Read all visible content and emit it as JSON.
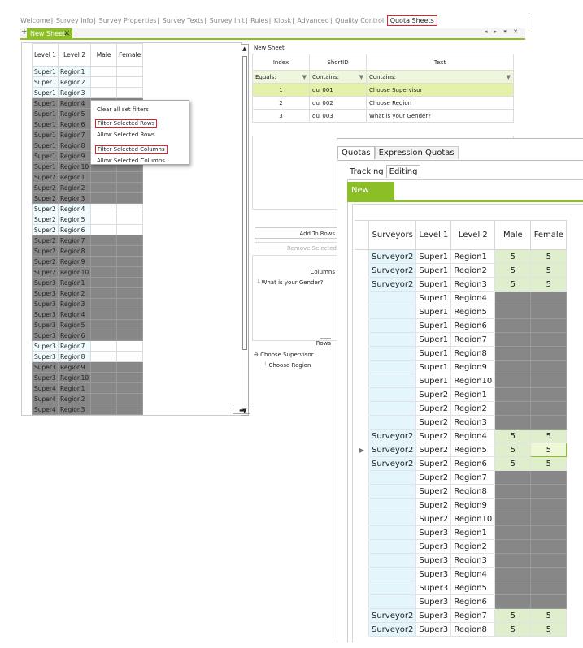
{
  "back_window": {
    "tabs": [
      "Welcome",
      "Survey Info",
      "Survey Properties",
      "Survey Texts",
      "Survey Init",
      "Rules",
      "Kiosk",
      "Advanced",
      "Quality Control",
      "Quota Sheets"
    ],
    "active_tab": "Quota Sheets",
    "sheet_tab": {
      "plus": "+",
      "label": "New Sheet",
      "close": "✕"
    },
    "window_controls": "◂ ▸ ▾ ✕",
    "grid": {
      "headers": [
        "Level 1",
        "Level 2",
        "Male",
        "Female"
      ],
      "rows": [
        {
          "l1": "Super1",
          "l2": "Region1",
          "g": false
        },
        {
          "l1": "Super1",
          "l2": "Region2",
          "g": false
        },
        {
          "l1": "Super1",
          "l2": "Region3",
          "g": false
        },
        {
          "l1": "Super1",
          "l2": "Region4",
          "g": true
        },
        {
          "l1": "Super1",
          "l2": "Region5",
          "g": true
        },
        {
          "l1": "Super1",
          "l2": "Region6",
          "g": true
        },
        {
          "l1": "Super1",
          "l2": "Region7",
          "g": true
        },
        {
          "l1": "Super1",
          "l2": "Region8",
          "g": true
        },
        {
          "l1": "Super1",
          "l2": "Region9",
          "g": true
        },
        {
          "l1": "Super1",
          "l2": "Region10",
          "g": true
        },
        {
          "l1": "Super2",
          "l2": "Region1",
          "g": true
        },
        {
          "l1": "Super2",
          "l2": "Region2",
          "g": true
        },
        {
          "l1": "Super2",
          "l2": "Region3",
          "g": true
        },
        {
          "l1": "Super2",
          "l2": "Region4",
          "g": false
        },
        {
          "l1": "Super2",
          "l2": "Region5",
          "g": false
        },
        {
          "l1": "Super2",
          "l2": "Region6",
          "g": false
        },
        {
          "l1": "Super2",
          "l2": "Region7",
          "g": true
        },
        {
          "l1": "Super2",
          "l2": "Region8",
          "g": true
        },
        {
          "l1": "Super2",
          "l2": "Region9",
          "g": true
        },
        {
          "l1": "Super2",
          "l2": "Region10",
          "g": true
        },
        {
          "l1": "Super3",
          "l2": "Region1",
          "g": true
        },
        {
          "l1": "Super3",
          "l2": "Region2",
          "g": true
        },
        {
          "l1": "Super3",
          "l2": "Region3",
          "g": true
        },
        {
          "l1": "Super3",
          "l2": "Region4",
          "g": true
        },
        {
          "l1": "Super3",
          "l2": "Region5",
          "g": true
        },
        {
          "l1": "Super3",
          "l2": "Region6",
          "g": true
        },
        {
          "l1": "Super3",
          "l2": "Region7",
          "g": false
        },
        {
          "l1": "Super3",
          "l2": "Region8",
          "g": false
        },
        {
          "l1": "Super3",
          "l2": "Region9",
          "g": true
        },
        {
          "l1": "Super3",
          "l2": "Region10",
          "g": true
        },
        {
          "l1": "Super4",
          "l2": "Region1",
          "g": true
        },
        {
          "l1": "Super4",
          "l2": "Region2",
          "g": true
        },
        {
          "l1": "Super4",
          "l2": "Region3",
          "g": true
        },
        {
          "l1": "Super4",
          "l2": "Region4",
          "g": true
        }
      ]
    },
    "context_menu": [
      "Clear all set filters",
      "Filter Selected Rows",
      "Allow Selected Rows",
      "Filter Selected Columns",
      "Allow Selected Columns"
    ],
    "right_pane": {
      "title": "New Sheet",
      "headers": [
        "Index",
        "ShortID",
        "Text"
      ],
      "filter_row": {
        "index": "Equals:",
        "shortid": "Contains:",
        "text": "Contains:"
      },
      "rows": [
        {
          "index": "1",
          "shortid": "qu_001",
          "text": "Choose Supervisor"
        },
        {
          "index": "2",
          "shortid": "qu_002",
          "text": "Choose Region"
        },
        {
          "index": "3",
          "shortid": "qu_003",
          "text": "What is your Gender?"
        }
      ],
      "add_rows": "Add To Rows",
      "remove_selected": "Remove Selected",
      "columns_label": "Columns",
      "columns_item": "What is your Gender?",
      "rows_label": "Rows",
      "rows_tree": [
        "Choose Supervisor",
        "Choose Region"
      ]
    }
  },
  "front_window": {
    "tabs": [
      "Quotas",
      "Expression Quotas"
    ],
    "subtabs": [
      "Tracking",
      "Editing"
    ],
    "sheet_tab": "New Sheet",
    "headers": [
      "Surveyors",
      "Level 1",
      "Level 2",
      "Male",
      "Female"
    ],
    "rows": [
      {
        "sv": "Surveyor2",
        "l1": "Super1",
        "l2": "Region1",
        "m": "5",
        "f": "5",
        "e": false
      },
      {
        "sv": "Surveyor2",
        "l1": "Super1",
        "l2": "Region2",
        "m": "5",
        "f": "5",
        "e": false
      },
      {
        "sv": "Surveyor2",
        "l1": "Super1",
        "l2": "Region3",
        "m": "5",
        "f": "5",
        "e": false
      },
      {
        "sv": "",
        "l1": "Super1",
        "l2": "Region4",
        "m": "",
        "f": "",
        "e": true
      },
      {
        "sv": "",
        "l1": "Super1",
        "l2": "Region5",
        "m": "",
        "f": "",
        "e": true
      },
      {
        "sv": "",
        "l1": "Super1",
        "l2": "Region6",
        "m": "",
        "f": "",
        "e": true
      },
      {
        "sv": "",
        "l1": "Super1",
        "l2": "Region7",
        "m": "",
        "f": "",
        "e": true
      },
      {
        "sv": "",
        "l1": "Super1",
        "l2": "Region8",
        "m": "",
        "f": "",
        "e": true
      },
      {
        "sv": "",
        "l1": "Super1",
        "l2": "Region9",
        "m": "",
        "f": "",
        "e": true
      },
      {
        "sv": "",
        "l1": "Super1",
        "l2": "Region10",
        "m": "",
        "f": "",
        "e": true
      },
      {
        "sv": "",
        "l1": "Super2",
        "l2": "Region1",
        "m": "",
        "f": "",
        "e": true
      },
      {
        "sv": "",
        "l1": "Super2",
        "l2": "Region2",
        "m": "",
        "f": "",
        "e": true
      },
      {
        "sv": "",
        "l1": "Super2",
        "l2": "Region3",
        "m": "",
        "f": "",
        "e": true
      },
      {
        "sv": "Surveyor2",
        "l1": "Super2",
        "l2": "Region4",
        "m": "5",
        "f": "5",
        "e": false
      },
      {
        "sv": "Surveyor2",
        "l1": "Super2",
        "l2": "Region5",
        "m": "5",
        "f": "5",
        "e": false,
        "current": true
      },
      {
        "sv": "Surveyor2",
        "l1": "Super2",
        "l2": "Region6",
        "m": "5",
        "f": "5",
        "e": false
      },
      {
        "sv": "",
        "l1": "Super2",
        "l2": "Region7",
        "m": "",
        "f": "",
        "e": true
      },
      {
        "sv": "",
        "l1": "Super2",
        "l2": "Region8",
        "m": "",
        "f": "",
        "e": true
      },
      {
        "sv": "",
        "l1": "Super2",
        "l2": "Region9",
        "m": "",
        "f": "",
        "e": true
      },
      {
        "sv": "",
        "l1": "Super2",
        "l2": "Region10",
        "m": "",
        "f": "",
        "e": true
      },
      {
        "sv": "",
        "l1": "Super3",
        "l2": "Region1",
        "m": "",
        "f": "",
        "e": true
      },
      {
        "sv": "",
        "l1": "Super3",
        "l2": "Region2",
        "m": "",
        "f": "",
        "e": true
      },
      {
        "sv": "",
        "l1": "Super3",
        "l2": "Region3",
        "m": "",
        "f": "",
        "e": true
      },
      {
        "sv": "",
        "l1": "Super3",
        "l2": "Region4",
        "m": "",
        "f": "",
        "e": true
      },
      {
        "sv": "",
        "l1": "Super3",
        "l2": "Region5",
        "m": "",
        "f": "",
        "e": true
      },
      {
        "sv": "",
        "l1": "Super3",
        "l2": "Region6",
        "m": "",
        "f": "",
        "e": true
      },
      {
        "sv": "Surveyor2",
        "l1": "Super3",
        "l2": "Region7",
        "m": "5",
        "f": "5",
        "e": false
      },
      {
        "sv": "Surveyor2",
        "l1": "Super3",
        "l2": "Region8",
        "m": "5",
        "f": "5",
        "e": false
      }
    ]
  },
  "colors": {
    "accent_green": "#8cbf26",
    "highlight_red": "#e0202a",
    "excluded_gray": "#878787",
    "value_green": "#dfeecd",
    "surveyor_blue": "#e4f6fb"
  }
}
